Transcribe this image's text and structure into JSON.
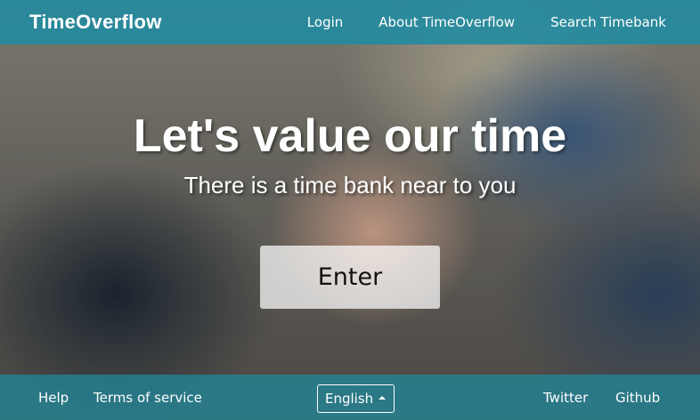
{
  "navbar": {
    "brand": "TimeOverflow",
    "links": [
      {
        "label": "Login"
      },
      {
        "label": "About TimeOverflow"
      },
      {
        "label": "Search Timebank"
      }
    ]
  },
  "hero": {
    "title": "Let's value our time",
    "subtitle": "There is a time bank near to you",
    "enter_label": "Enter"
  },
  "footer": {
    "help_label": "Help",
    "terms_label": "Terms of service",
    "language": {
      "selected": "English",
      "icon": "caret-up-icon"
    },
    "twitter_label": "Twitter",
    "github_label": "Github"
  },
  "colors": {
    "bar": "#1f8ba0",
    "text": "#ffffff"
  }
}
